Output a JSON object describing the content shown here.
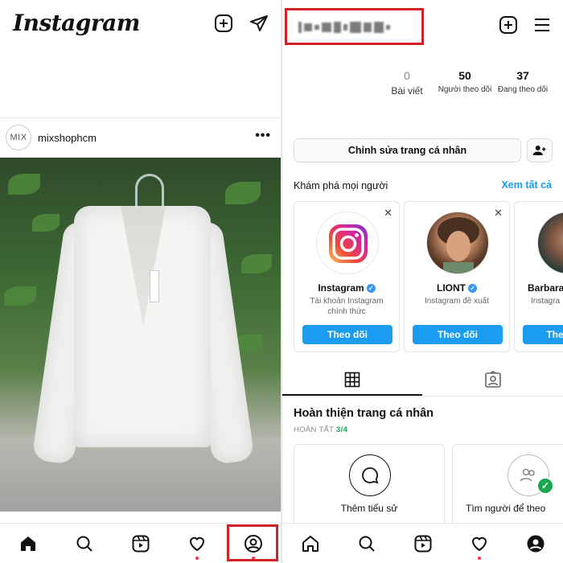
{
  "left": {
    "logo": "Instagram",
    "post": {
      "avatar_text": "MIX",
      "username": "mixshophcm",
      "more": "•••"
    },
    "nav": [
      "home",
      "search",
      "reels",
      "activity",
      "profile"
    ]
  },
  "right": {
    "stats": [
      {
        "value": "0",
        "label": "Bài viết"
      },
      {
        "value": "50",
        "label": "Người theo dõi"
      },
      {
        "value": "37",
        "label": "Đang theo dõi"
      }
    ],
    "edit_profile": "Chỉnh sửa trang cá nhân",
    "discover_title": "Khám phá mọi người",
    "see_all": "Xem tất cả",
    "suggestions": [
      {
        "name": "Instagram",
        "verified": true,
        "sub": "Tài khoản Instagram chính thức",
        "follow": "Theo dõi"
      },
      {
        "name": "LIONT",
        "verified": true,
        "sub": "Instagram đề xuất",
        "follow": "Theo dõi"
      },
      {
        "name": "Barbara",
        "verified": false,
        "sub": "Instagra",
        "follow": "The"
      }
    ],
    "complete_title": "Hoàn thiện trang cá nhân",
    "complete_label": "HOÀN TẤT",
    "complete_progress": "3/4",
    "complete_cards": [
      {
        "title": "Thêm tiểu sử"
      },
      {
        "title": "Tìm người để theo"
      }
    ]
  },
  "colors": {
    "accent": "#1a9cf0",
    "highlight_box": "#d32026",
    "progress": "#18a84c"
  }
}
